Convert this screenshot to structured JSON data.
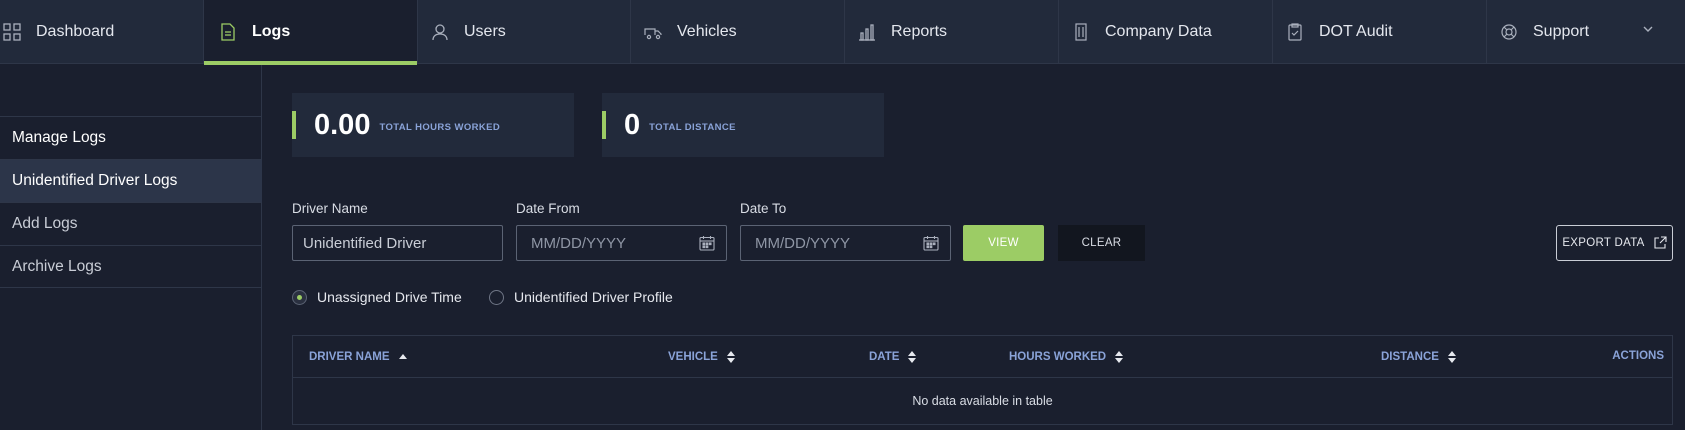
{
  "nav": {
    "items": [
      {
        "label": "Dashboard",
        "icon": "grid-icon"
      },
      {
        "label": "Logs",
        "icon": "document-icon"
      },
      {
        "label": "Users",
        "icon": "user-icon"
      },
      {
        "label": "Vehicles",
        "icon": "truck-icon"
      },
      {
        "label": "Reports",
        "icon": "bar-chart-icon"
      },
      {
        "label": "Company Data",
        "icon": "building-icon"
      },
      {
        "label": "DOT Audit",
        "icon": "clipboard-check-icon"
      },
      {
        "label": "Support",
        "icon": "lifebuoy-icon"
      }
    ],
    "active": "Logs",
    "accent_color": "#9ccc65"
  },
  "sidebar": {
    "items": [
      {
        "label": "Manage Logs"
      },
      {
        "label": "Unidentified Driver Logs"
      },
      {
        "label": "Add Logs"
      },
      {
        "label": "Archive Logs"
      }
    ],
    "active": "Unidentified Driver Logs"
  },
  "stats": [
    {
      "value": "0.00",
      "label": "TOTAL HOURS WORKED"
    },
    {
      "value": "0",
      "label": "TOTAL DISTANCE"
    }
  ],
  "filters": {
    "driver_name_label": "Driver Name",
    "driver_name_value": "Unidentified Driver",
    "date_from_label": "Date From",
    "date_from_placeholder": "MM/DD/YYYY",
    "date_to_label": "Date To",
    "date_to_placeholder": "MM/DD/YYYY",
    "view_label": "VIEW",
    "clear_label": "CLEAR",
    "export_label": "EXPORT DATA"
  },
  "radios": [
    {
      "label": "Unassigned Drive Time",
      "checked": true
    },
    {
      "label": "Unidentified Driver Profile",
      "checked": false
    }
  ],
  "table": {
    "columns": [
      "DRIVER NAME",
      "VEHICLE",
      "DATE",
      "HOURS WORKED",
      "DISTANCE",
      "ACTIONS"
    ],
    "empty_text": "No data available in table"
  }
}
